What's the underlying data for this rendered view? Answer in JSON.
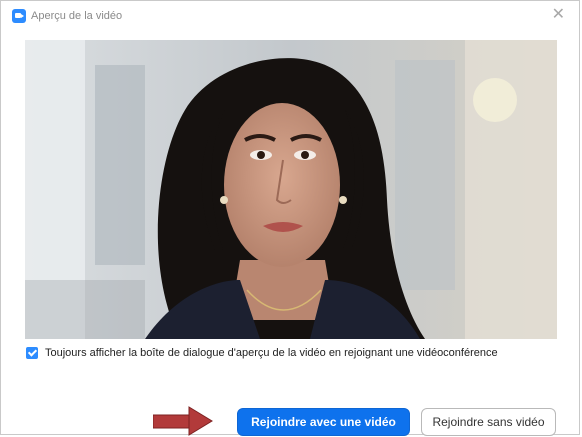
{
  "window": {
    "title": "Aperçu de la vidéo",
    "close_glyph": "✕"
  },
  "preview": {
    "icon": "video-preview"
  },
  "options": {
    "always_show_label": "Toujours afficher la boîte de dialogue d'aperçu de la vidéo en rejoignant une vidéoconférence",
    "always_show_checked": true
  },
  "buttons": {
    "join_with_video": "Rejoindre avec une vidéo",
    "join_without_video": "Rejoindre sans vidéo"
  },
  "colors": {
    "accent": "#0e72ed",
    "arrow": "#b23a3a"
  }
}
